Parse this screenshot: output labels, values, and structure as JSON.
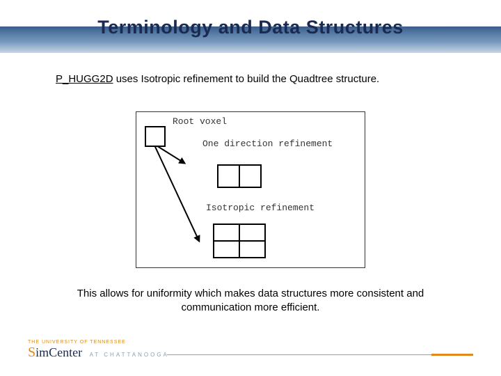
{
  "title": "Terminology and Data Structures",
  "subtitle_prefix": "P_HUGG2D",
  "subtitle_rest": " uses Isotropic refinement to build the Quadtree structure.",
  "diagram": {
    "root_label": "Root voxel",
    "onedir_label": "One direction refinement",
    "iso_label": "Isotropic refinement"
  },
  "bottom_text": "This allows for uniformity which makes data structures more consistent and communication more efficient.",
  "footer": {
    "ut": "THE UNIVERSITY OF TENNESSEE",
    "sim_s": "S",
    "sim_rest": "imCenter",
    "chatt": "AT  CHATTANOOGA"
  }
}
